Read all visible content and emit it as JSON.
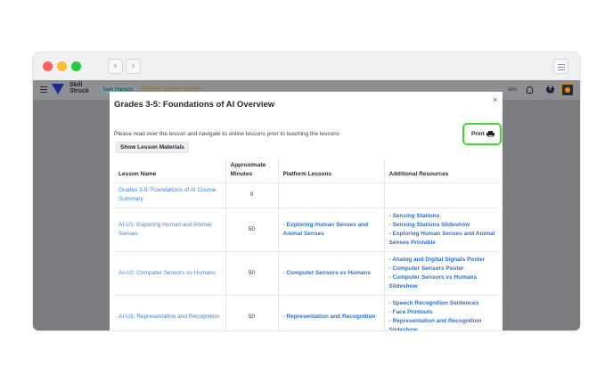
{
  "browser": {
    "back_glyph": "‹",
    "forward_glyph": "›"
  },
  "app": {
    "logo_line1": "Skill",
    "logo_line2": "Struck",
    "tab_primary": "Sam Hanson",
    "tab_secondary": "Explore Upgrade Options",
    "user_name": "Ann",
    "help_glyph": "?"
  },
  "modal": {
    "title": "Grades 3-5: Foundations of AI Overview",
    "close_glyph": "×",
    "intro": "Please read over the lesson and navigate to online lessons prior to teaching the lessons",
    "print_label": "Print",
    "show_materials_label": "Show Lesson Materials",
    "columns": [
      "Lesson Name",
      "Approximate Minutes",
      "Platform Lessons",
      "Additional Resources"
    ],
    "rows": [
      {
        "lesson": "Grades 3-5: Foundations of AI Course Summary",
        "minutes": "0",
        "platform": "",
        "resources": []
      },
      {
        "lesson": "AI-U1: Exploring Human and Animal Senses",
        "minutes": "50",
        "platform": "- Exploring Human Senses and Animal Senses",
        "resources": [
          "- Sensing Stations",
          "- Sensing Stations Slideshow",
          "- Exploring Human Senses and Animal Senses Printable"
        ]
      },
      {
        "lesson": "AI-U2: Computer Sensors vs Humans",
        "minutes": "50",
        "platform": "- Computer Sensors vs Humans",
        "resources": [
          "- Analog and Digital Signals Poster",
          "- Computer Sensors Poster",
          "- Computer Sensors vs Humans Slideshow"
        ]
      },
      {
        "lesson": "AI-U3: Representation and Recognition",
        "minutes": "50",
        "platform": "- Representation and Recognition",
        "resources": [
          "- Speech Recognition Sentences",
          "- Face Printouts",
          "- Representation and Recognition Slideshow"
        ]
      }
    ]
  },
  "colors": {
    "accent_link": "#2b6fd6",
    "print_highlight": "#3ddc2b",
    "overlay": "#7a7c80"
  },
  "icons": [
    "close-icon",
    "printer-icon",
    "bell-icon",
    "help-icon",
    "hamburger-icon",
    "settings-icon"
  ]
}
